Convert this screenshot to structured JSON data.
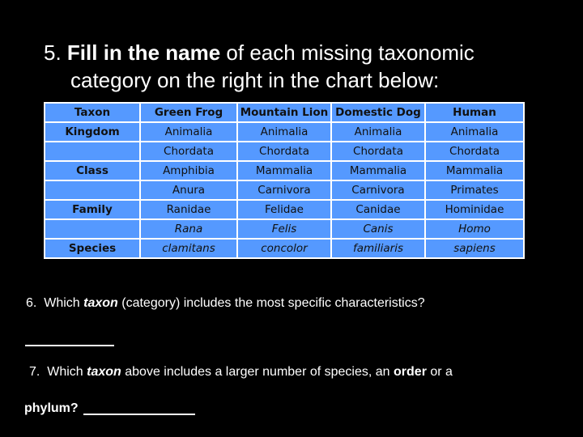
{
  "question5": {
    "number": "5.",
    "bold": "Fill in the name",
    "rest_line1": "of each missing taxonomic",
    "line2": "category on the right in the chart below:"
  },
  "table": {
    "headers": [
      "Taxon",
      "Green Frog",
      "Mountain Lion",
      "Domestic Dog",
      "Human"
    ],
    "rows": [
      {
        "rank": "Kingdom",
        "values": [
          "Animalia",
          "Animalia",
          "Animalia",
          "Animalia"
        ],
        "italic": false
      },
      {
        "rank": "",
        "values": [
          "Chordata",
          "Chordata",
          "Chordata",
          "Chordata"
        ],
        "italic": false
      },
      {
        "rank": "Class",
        "values": [
          "Amphibia",
          "Mammalia",
          "Mammalia",
          "Mammalia"
        ],
        "italic": false
      },
      {
        "rank": "",
        "values": [
          "Anura",
          "Carnivora",
          "Carnivora",
          "Primates"
        ],
        "italic": false
      },
      {
        "rank": "Family",
        "values": [
          "Ranidae",
          "Felidae",
          "Canidae",
          "Hominidae"
        ],
        "italic": false
      },
      {
        "rank": "",
        "values": [
          "Rana",
          "Felis",
          "Canis",
          "Homo"
        ],
        "italic": true
      },
      {
        "rank": "Species",
        "values": [
          "clamitans",
          "concolor",
          "familiaris",
          "sapiens"
        ],
        "italic": true
      }
    ],
    "colors": {
      "cell_bg": "#5599ff",
      "border": "#ffffff",
      "text": "#111111"
    }
  },
  "question6": {
    "prefix": "6.  Which ",
    "italic_bold": "taxon",
    "suffix": " (category) includes the most specific characteristics?"
  },
  "question7": {
    "prefix": "7.  Which ",
    "italic_bold": "taxon",
    "middle": " above includes a larger number of species, an ",
    "bold_order": "order",
    "end": " or a",
    "line2_bold": "phylum?"
  }
}
